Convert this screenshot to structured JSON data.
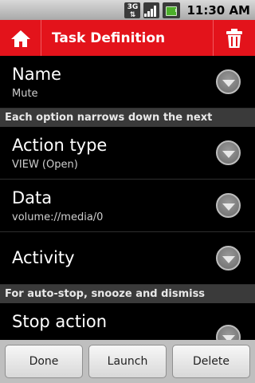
{
  "status_bar": {
    "network_type": "3G",
    "time": "11:30 AM"
  },
  "title_bar": {
    "title": "Task Definition",
    "home_icon": "home-icon",
    "delete_icon": "trash-icon",
    "background_color": "#e3131b"
  },
  "rows": [
    {
      "title": "Name",
      "subtitle": "Mute"
    },
    {
      "title": "Action type",
      "subtitle": "VIEW (Open)"
    },
    {
      "title": "Data",
      "subtitle": "volume://media/0"
    },
    {
      "title": "Activity",
      "subtitle": ""
    },
    {
      "title": "Stop action",
      "subtitle": ""
    }
  ],
  "sections": [
    "Each option narrows down the next",
    "For auto-stop, snooze and dismiss"
  ],
  "buttons": {
    "done": "Done",
    "launch": "Launch",
    "delete": "Delete"
  }
}
